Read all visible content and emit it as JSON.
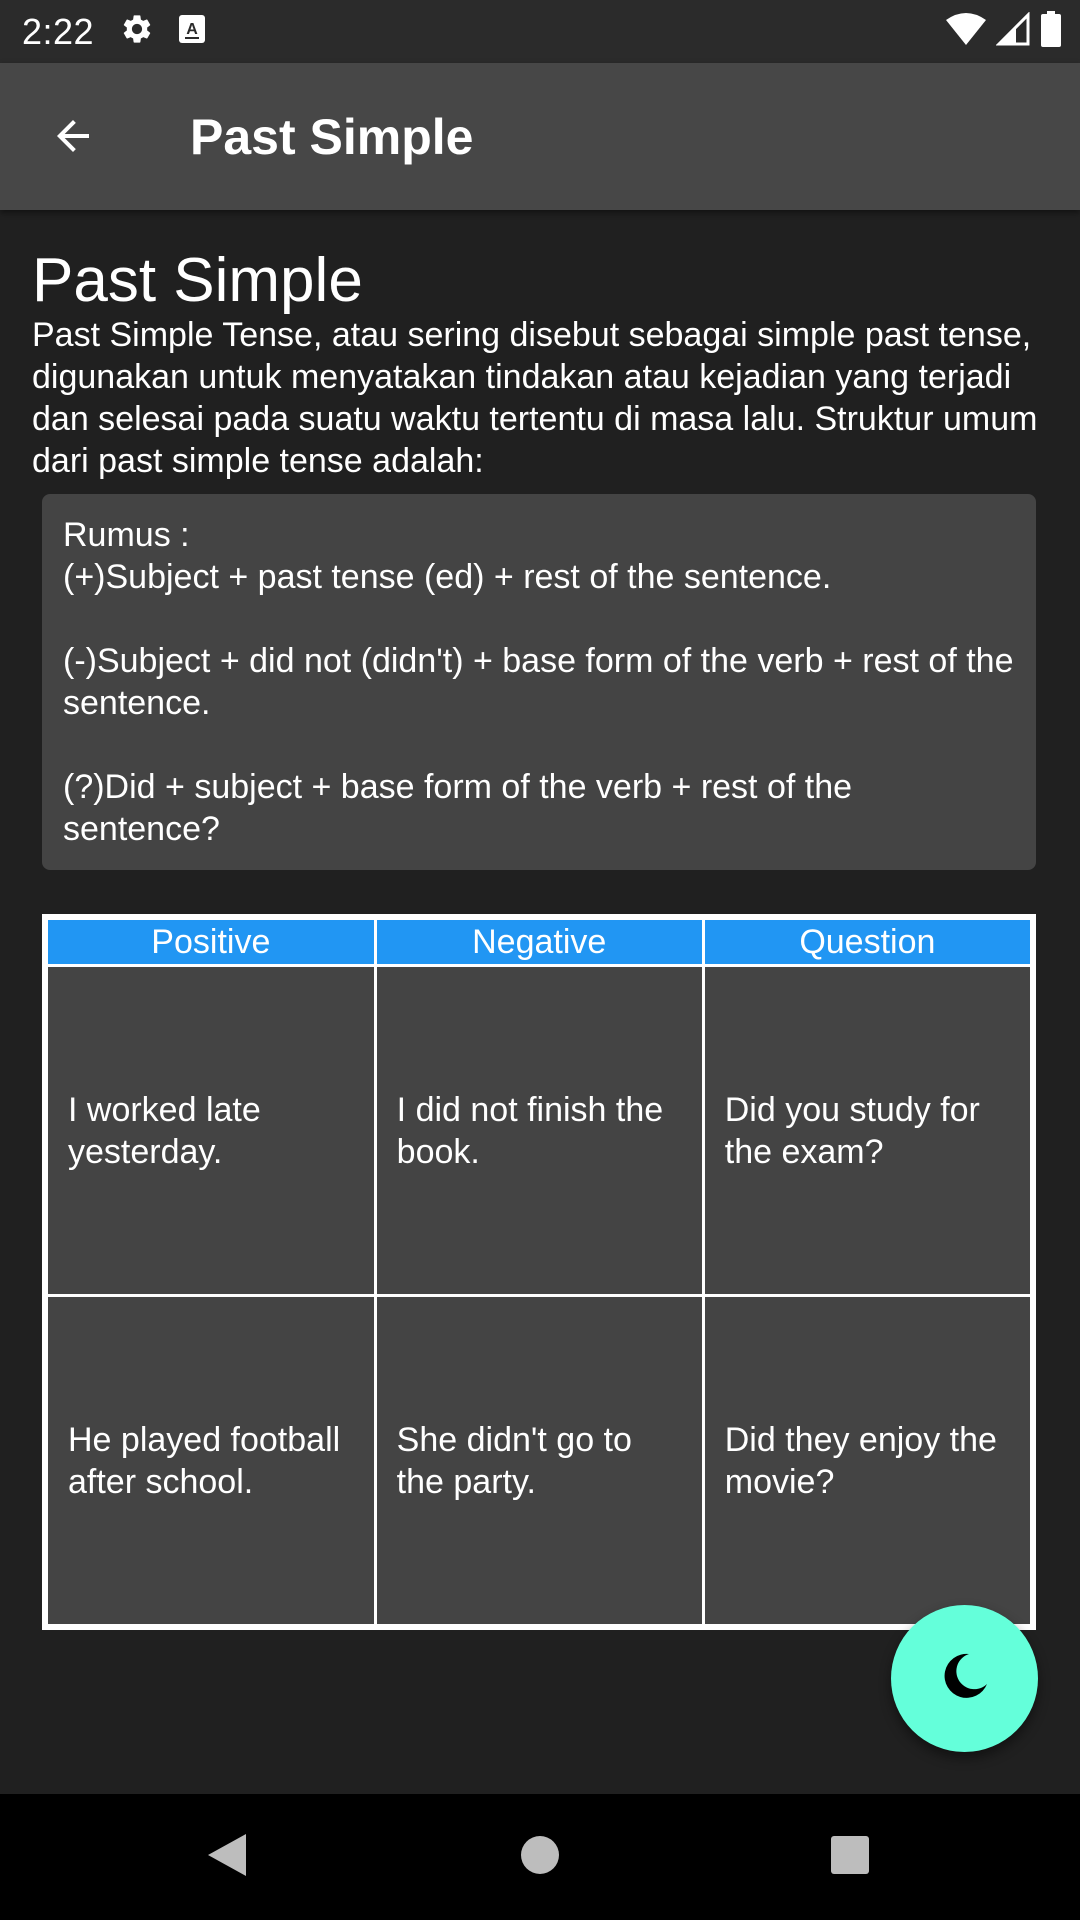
{
  "status_bar": {
    "time": "2:22",
    "left_icons": [
      "settings-icon",
      "keyboard-a-icon"
    ],
    "right_icons": [
      "wifi-icon",
      "cell-signal-icon",
      "battery-icon"
    ]
  },
  "app_bar": {
    "title": "Past Simple",
    "back_icon": "arrow-back-icon"
  },
  "main": {
    "heading": "Past Simple",
    "intro": "Past Simple Tense, atau sering disebut sebagai simple past tense, digunakan untuk menyatakan tindakan atau kejadian yang terjadi dan selesai pada suatu waktu tertentu di masa lalu. Struktur umum dari past simple tense adalah:",
    "formula": {
      "label": "Rumus :",
      "positive": "(+)Subject + past tense (ed) + rest of the sentence.",
      "negative": "(-)Subject + did not (didn't) + base form of the verb + rest of the sentence.",
      "question": "(?)Did + subject + base form of the verb + rest of the sentence?"
    },
    "table": {
      "headers": [
        "Positive",
        "Negative",
        "Question"
      ],
      "rows": [
        [
          "I worked late yesterday.",
          "I did not finish the book.",
          "Did you study for the exam?"
        ],
        [
          "He played football after school.",
          "She didn't go to the party.",
          "Did they enjoy the movie?"
        ]
      ]
    }
  },
  "fab": {
    "icon": "moon-icon"
  },
  "nav_bar": {
    "icons": [
      "back-triangle-icon",
      "home-circle-icon",
      "recents-square-icon"
    ]
  },
  "colors": {
    "background": "#202020",
    "app_bar": "#474747",
    "card": "#444444",
    "table_header": "#2196f3",
    "fab": "#64ffda"
  }
}
